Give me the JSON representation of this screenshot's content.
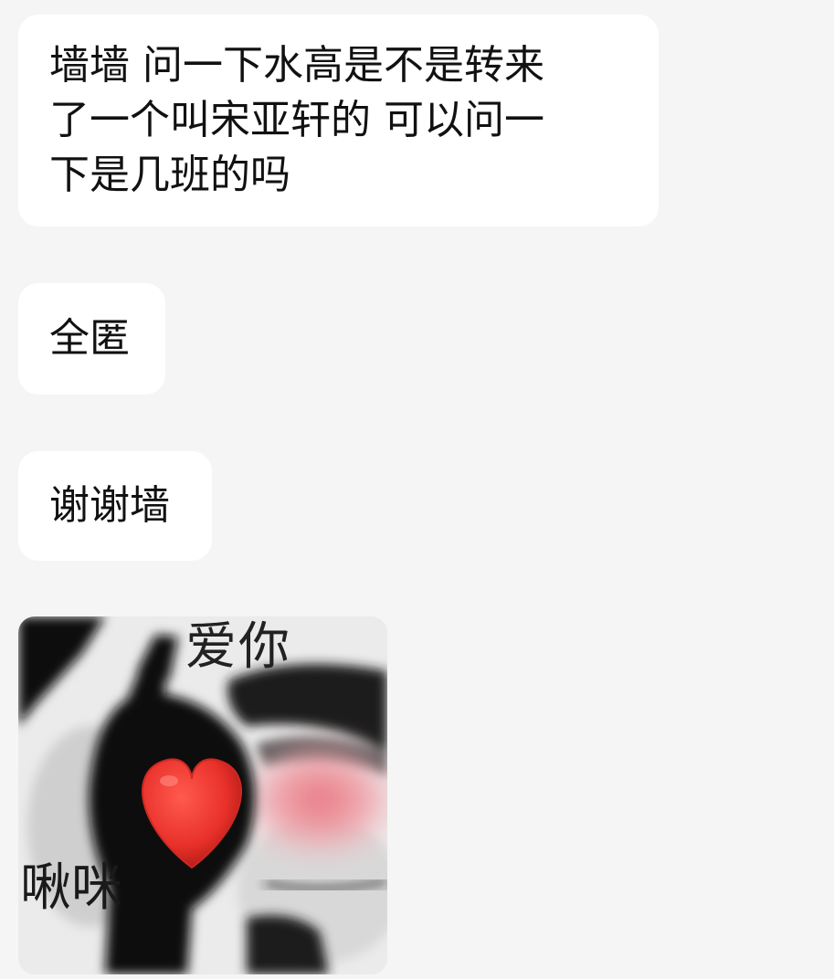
{
  "messages": [
    {
      "text": "墙墙 问一下水高是不是转来\n了一个叫宋亚轩的 可以问一\n下是几班的吗"
    },
    {
      "text": "全匿"
    },
    {
      "text": "谢谢墙"
    }
  ],
  "sticker": {
    "caption_top": "爱你",
    "caption_bottom": "啾咪",
    "heart_color": "#e8302a"
  },
  "colors": {
    "background": "#f5f5f5",
    "bubble": "#ffffff",
    "text": "#111111"
  }
}
